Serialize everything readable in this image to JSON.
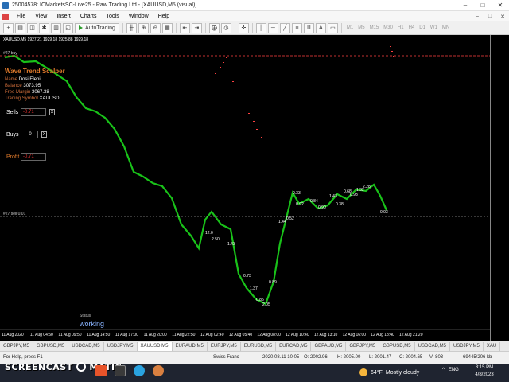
{
  "window": {
    "title": "25004578: ICMarketsSC-Live25 - Raw Trading Ltd - [XAUUSD,M5 (visual)]",
    "min": "–",
    "max": "□",
    "close": "✕"
  },
  "menu": [
    "File",
    "View",
    "Insert",
    "Charts",
    "Tools",
    "Window",
    "Help"
  ],
  "toolbar": {
    "autotrading": "AutoTrading",
    "timeframes": [
      "M1",
      "M5",
      "M15",
      "M30",
      "H1",
      "H4",
      "D1",
      "W1",
      "MN"
    ]
  },
  "chart": {
    "symbol_line": "XAUUSD,M5  1927.21 1929.18 1925.88 1929.18",
    "colors": {
      "background": "#000000",
      "candles": "#19c219",
      "level": "#ff4040"
    },
    "level_top_label": "#27 buy",
    "level_mid_label": "#27 sell 0.01",
    "price_labels": [
      "2031.46",
      "2021.26",
      "2010.98",
      "2000.68",
      "1990.70",
      "1980.50",
      "1970.32",
      "1960.14",
      "1949.96",
      "1940.20",
      "1929.18",
      "1919.60",
      "1909.36",
      "1899.16",
      "1889.04",
      "1879.00",
      "1869.28",
      "1858.64"
    ],
    "current_price": "1929.18",
    "time_labels": [
      "11 Aug 2020",
      "11 Aug 04:50",
      "11 Aug 09:50",
      "11 Aug 14:50",
      "11 Aug 17:00",
      "11 Aug 20:00",
      "11 Aug 22:50",
      "12 Aug 02:40",
      "12 Aug 05:40",
      "12 Aug 08:00",
      "12 Aug 10:40",
      "12 Aug 13:10",
      "12 Aug 16:00",
      "12 Aug 18:40",
      "12 Aug 21:20"
    ],
    "trade_labels": [
      "0.03",
      "0.84",
      "0.90",
      "1.43",
      "0.38",
      "0.68",
      "0.93",
      "1.32",
      "2.28",
      "12.0",
      "0.92",
      "2.50",
      "1.43",
      "0.73",
      "1.37",
      "0.85",
      "2.05",
      "0.89",
      "1.44",
      "0.52",
      "0.33"
    ]
  },
  "indicator": {
    "title": "Wave Trend Scalper",
    "name_k": "Name",
    "name_v": "Dosi Eleni",
    "balance_k": "Balance",
    "balance_v": "3073.95",
    "free_margin_k": "Free Margin",
    "free_margin_v": "3067.38",
    "symbol_k": "Trading Symbol",
    "symbol_v": "XAUUSD",
    "sells_label": "Sells",
    "sells_value": "-0.71",
    "buys_label": "Buys",
    "buys_value": "0",
    "profit_label": "Profit",
    "profit_value": "-0.71",
    "x_button": "X",
    "status_label": "Status",
    "status_value": "working"
  },
  "tabs": [
    "GBPJPY,M5",
    "GBPUSD,M5",
    "USDCAD,M5",
    "USDJPY,M5",
    "XAUUSD,M5",
    "EURAUD,M5",
    "EURJPY,M5",
    "EURUSD,M5",
    "EURCAD,M5",
    "GBPAUD,M5",
    "GBPJPY,M5",
    "GBPUSD,M5",
    "USDCAD,M5",
    "USDJPY,M5",
    "XAU"
  ],
  "active_tab_index": 4,
  "statusbar": {
    "help": "For Help, press F1",
    "profile": "Swiss Franc",
    "datetime": "2020.08.11 10:05",
    "open": "O: 2002.96",
    "high": "H: 2005.00",
    "low": "L: 2001.47",
    "close": "C: 2004.65",
    "volume": "V: 803",
    "traffic": "69445/206 kb"
  },
  "taskbar": {
    "watermark_a": "SCREENCAST",
    "watermark_b": "MATIC",
    "weather_temp": "64°F",
    "weather_text": "Mostly cloudy",
    "lang": "ENG",
    "time": "3:15 PM",
    "date": "4/8/2023"
  }
}
